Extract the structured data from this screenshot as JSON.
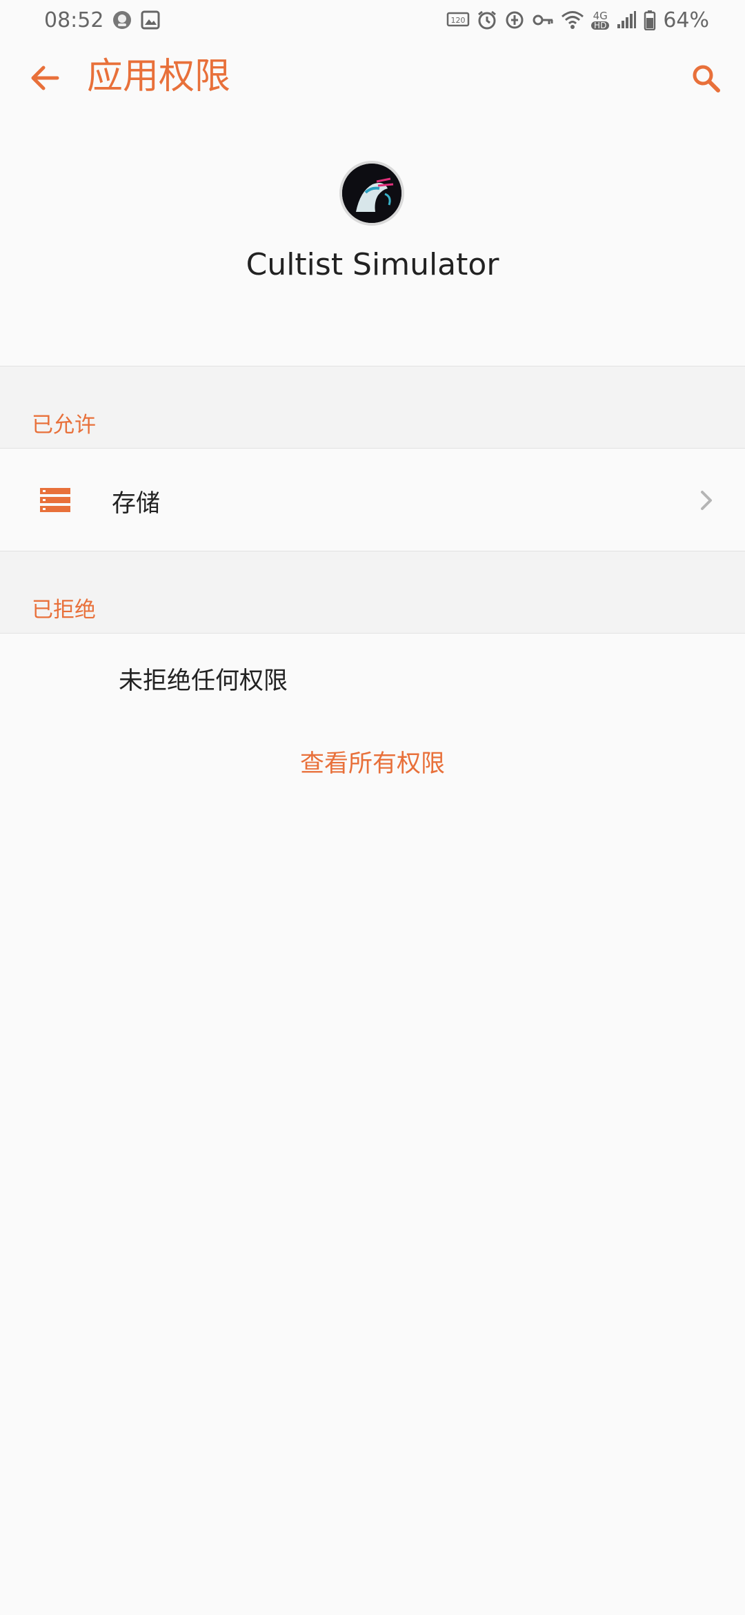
{
  "status_bar": {
    "time": "08:52",
    "battery": "64%",
    "network": "4G",
    "hd": "HD"
  },
  "app_bar": {
    "title": "应用权限"
  },
  "app": {
    "name": "Cultist Simulator"
  },
  "sections": {
    "allowed": {
      "title": "已允许",
      "items": [
        {
          "label": "存储",
          "icon": "storage-icon"
        }
      ]
    },
    "denied": {
      "title": "已拒绝",
      "empty_text": "未拒绝任何权限"
    }
  },
  "view_all_link": "查看所有权限",
  "colors": {
    "accent": "#e8703a",
    "background": "#fafafa",
    "section_bg": "#f3f3f3"
  }
}
